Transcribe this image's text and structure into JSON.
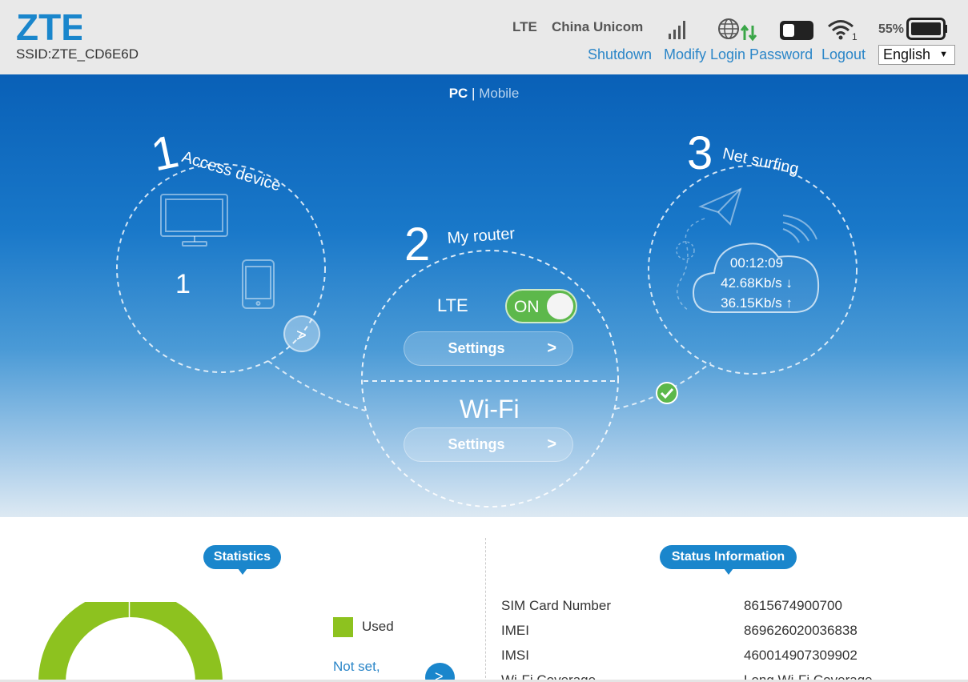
{
  "header": {
    "brand": "ZTE",
    "ssid": "SSID:ZTE_CD6E6D",
    "network_type": "LTE",
    "carrier": "China Unicom",
    "battery_percent": "55%",
    "wifi_clients": "1",
    "links": {
      "shutdown": "Shutdown",
      "modify_password": "Modify Login Password",
      "logout": "Logout"
    },
    "language": "English",
    "icons": [
      "signal-strength-icon",
      "globe-icon",
      "data-arrows-icon",
      "sms-icon",
      "wifi-icon",
      "battery-icon"
    ],
    "colors": {
      "brand_blue": "#1a86cc",
      "link": "#2b86c8",
      "data_green": "#3aa648"
    }
  },
  "hero": {
    "view_toggle": {
      "pc": "PC",
      "separator": "|",
      "mobile": "Mobile"
    },
    "step1": {
      "number": "1",
      "label": "Access  device",
      "device_count": "1"
    },
    "step2": {
      "number": "2",
      "label": "My router",
      "lte_label": "LTE",
      "lte_toggle": "ON",
      "lte_settings": "Settings",
      "wifi_label": "Wi-Fi",
      "wifi_settings": "Settings"
    },
    "step3": {
      "number": "3",
      "label": "Net surfing",
      "connected_time": "00:12:09",
      "download_rate": "42.68Kb/s ↓",
      "upload_rate": "36.15Kb/s ↑"
    }
  },
  "statistics": {
    "title": "Statistics",
    "legend_used": "Used",
    "not_set": "Not set,",
    "used_color": "#8dc21f"
  },
  "status_info": {
    "title": "Status Information",
    "rows": [
      {
        "label": "SIM Card Number",
        "value": "8615674900700"
      },
      {
        "label": "IMEI",
        "value": "869626020036838"
      },
      {
        "label": "IMSI",
        "value": "460014907309902"
      },
      {
        "label": "Wi-Fi Coverage",
        "value": "Long Wi-Fi Coverage"
      }
    ]
  }
}
